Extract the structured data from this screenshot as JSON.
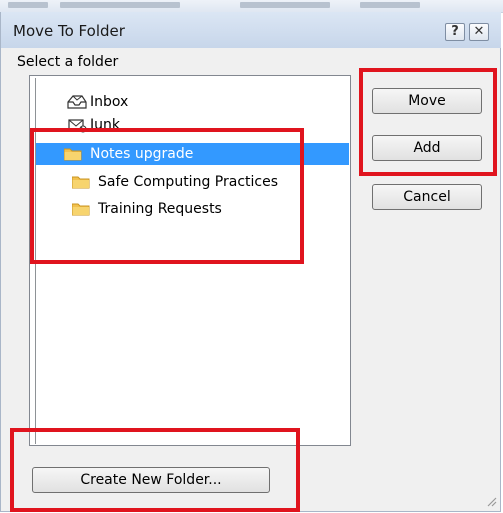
{
  "dialog": {
    "title": "Move To Folder",
    "help_glyph": "?",
    "close_glyph": "✕",
    "select_label": "Select a folder"
  },
  "folders": [
    {
      "label": "Inbox",
      "icon": "inbox-icon"
    },
    {
      "label": "Junk",
      "icon": "junk-icon"
    },
    {
      "label": "Notes upgrade",
      "icon": "folder-icon",
      "selected": true
    },
    {
      "label": "Safe Computing Practices",
      "icon": "folder-icon"
    },
    {
      "label": "Training Requests",
      "icon": "folder-icon"
    }
  ],
  "buttons": {
    "move": "Move",
    "add": "Add",
    "cancel": "Cancel",
    "create_new_folder": "Create New Folder..."
  },
  "colors": {
    "selection": "#3399ff",
    "highlight": "#e0141e",
    "folder": "#f2c14e"
  }
}
